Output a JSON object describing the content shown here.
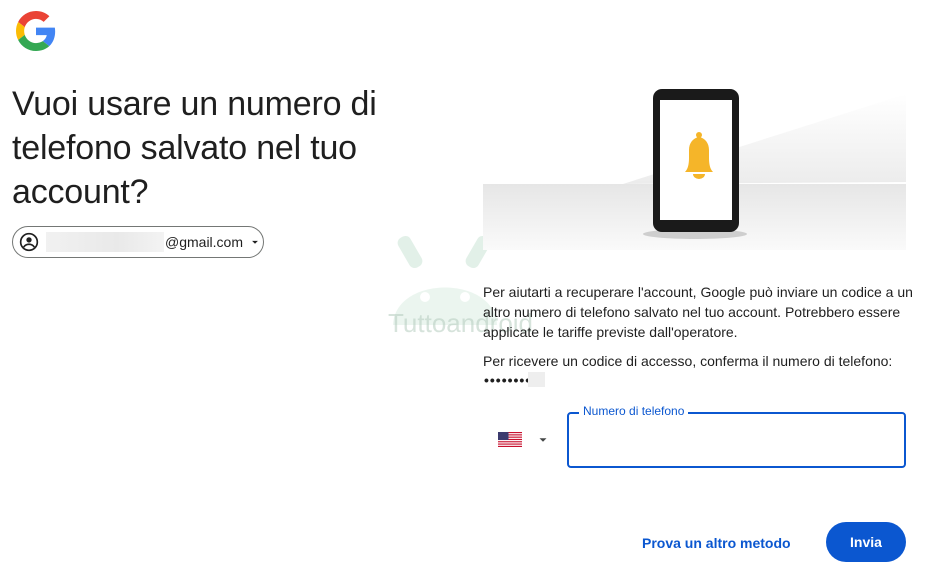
{
  "logo": {
    "icon": "google-g-icon"
  },
  "page": {
    "title": "Vuoi usare un numero di telefono salvato nel tuo account?"
  },
  "account": {
    "email_suffix": "@gmail.com",
    "avatar_icon": "account-circle-icon",
    "chevron_icon": "chevron-down-icon"
  },
  "watermark": {
    "text": "Tuttoandroid"
  },
  "info": {
    "paragraph1": "Per aiutarti a recuperare l'account, Google può inviare un codice a un altro numero di telefono salvato nel tuo account. Potrebbero essere applicate le tariffe previste dall'operatore.",
    "paragraph2": "Per ricevere un codice di accesso, conferma il numero di telefono:",
    "masked_number": "••••••••"
  },
  "phone": {
    "country_flag": "us-flag-icon",
    "field_label": "Numero di telefono",
    "value": ""
  },
  "actions": {
    "alternate_label": "Prova un altro metodo",
    "submit_label": "Invia"
  },
  "colors": {
    "accent": "#0b57d0",
    "bell": "#f5b529",
    "text": "#1f1f1f"
  }
}
